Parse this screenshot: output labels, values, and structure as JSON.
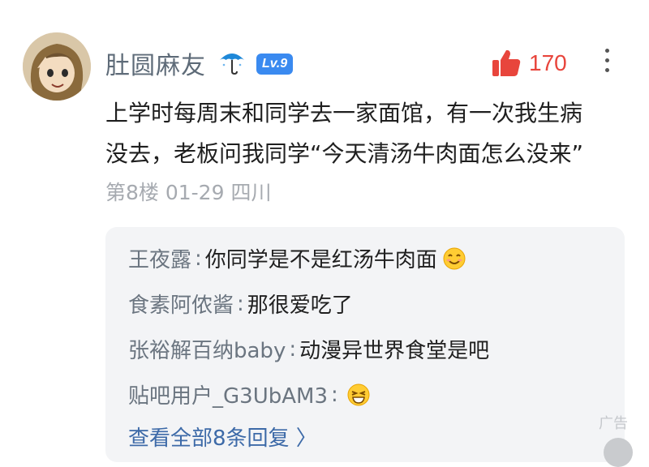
{
  "post": {
    "username": "肚圆麻友",
    "level": "Lv.9",
    "likes": "170",
    "content_line1": "上学时每周末和同学去一家面馆，有一次我生病",
    "content_line2": "没去，老板问我同学“今天清汤牛肉面怎么没来”",
    "meta": "第8楼 01-29 四川"
  },
  "replies": [
    {
      "name": "王夜露",
      "text": "你同学是不是红汤牛肉面",
      "emoji": "smile-emoji"
    },
    {
      "name": "食素阿侬酱",
      "text": "那很爱吃了",
      "emoji": ""
    },
    {
      "name": "张裕解百纳baby",
      "text": "动漫异世界食堂是吧",
      "emoji": ""
    },
    {
      "name": "贴吧用户_G3UbAM3",
      "text": "",
      "emoji": "grin-emoji"
    }
  ],
  "view_all": "查看全部8条回复 〉",
  "ad_label": "广告",
  "colors": {
    "username": "#5e6b78",
    "like": "#e8453c",
    "level_badge": "#3a8af0",
    "link": "#3d6aa8"
  }
}
